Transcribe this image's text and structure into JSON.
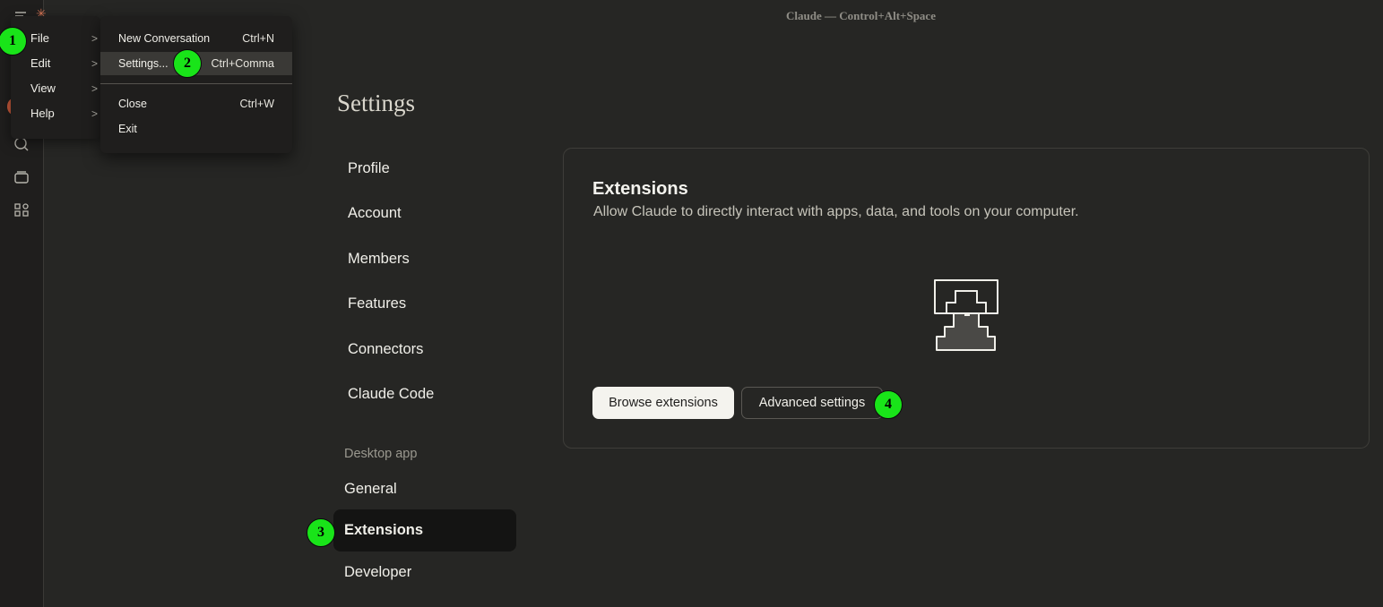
{
  "window": {
    "title": "Claude — Control+Alt+Space"
  },
  "rail": {
    "icons": [
      "menu-icon",
      "chat-icon",
      "projects-icon",
      "artifacts-icon"
    ]
  },
  "menu_bar": {
    "items": [
      {
        "label": "File"
      },
      {
        "label": "Edit"
      },
      {
        "label": "View"
      },
      {
        "label": "Help"
      }
    ],
    "chevron": ">"
  },
  "file_menu": {
    "items": [
      {
        "label": "New Conversation",
        "shortcut": "Ctrl+N"
      },
      {
        "label": "Settings...",
        "shortcut": "Ctrl+Comma"
      },
      {
        "label": "Close",
        "shortcut": "Ctrl+W"
      },
      {
        "label": "Exit",
        "shortcut": ""
      }
    ]
  },
  "settings": {
    "title": "Settings",
    "nav": [
      {
        "label": "Profile"
      },
      {
        "label": "Account"
      },
      {
        "label": "Members"
      },
      {
        "label": "Features"
      },
      {
        "label": "Connectors"
      },
      {
        "label": "Claude Code"
      }
    ],
    "desktop_section": "Desktop app",
    "desktop_nav": [
      {
        "label": "General"
      },
      {
        "label": "Extensions"
      },
      {
        "label": "Developer"
      }
    ]
  },
  "extensions": {
    "title": "Extensions",
    "description": "Allow Claude to directly interact with apps, data, and tools on your computer.",
    "browse_button": "Browse extensions",
    "advanced_button": "Advanced settings"
  },
  "markers": [
    "1",
    "2",
    "3",
    "4"
  ],
  "colors": {
    "marker": "#19e419",
    "accent": "#d97757",
    "active_nav": "#141413"
  }
}
